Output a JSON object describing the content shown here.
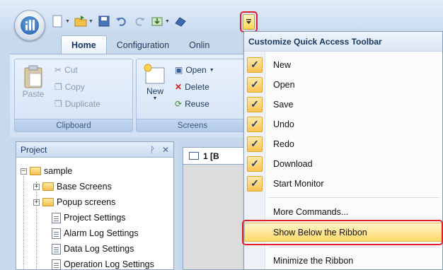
{
  "ribbon": {
    "tabs": [
      "Home",
      "Configuration",
      "Onlin"
    ],
    "clipboard": {
      "cut": "Cut",
      "copy": "Copy",
      "paste": "Paste",
      "duplicate": "Duplicate",
      "group_label": "Clipboard"
    },
    "screens": {
      "new": "New",
      "open": "Open",
      "delete": "Delete",
      "reuse": "Reuse",
      "group_label": "Screens"
    }
  },
  "project_panel": {
    "title": "Project",
    "pin_icon": "pin-icon",
    "close_glyph": "✕",
    "tree": {
      "root": "sample",
      "items": [
        "Base Screens",
        "Popup screens",
        "Project Settings",
        "Alarm Log Settings",
        "Data Log Settings",
        "Operation Log Settings"
      ]
    }
  },
  "document": {
    "tab_label": "1 [B"
  },
  "customize_menu": {
    "title": "Customize Quick Access Toolbar",
    "checked_items": [
      "New",
      "Open",
      "Save",
      "Undo",
      "Redo",
      "Download",
      "Start Monitor"
    ],
    "more_commands": "More Commands...",
    "show_below": "Show Below the Ribbon",
    "minimize": "Minimize the Ribbon"
  },
  "colors": {
    "highlight_frame": "#e0202a",
    "accent": "#fcc451"
  }
}
